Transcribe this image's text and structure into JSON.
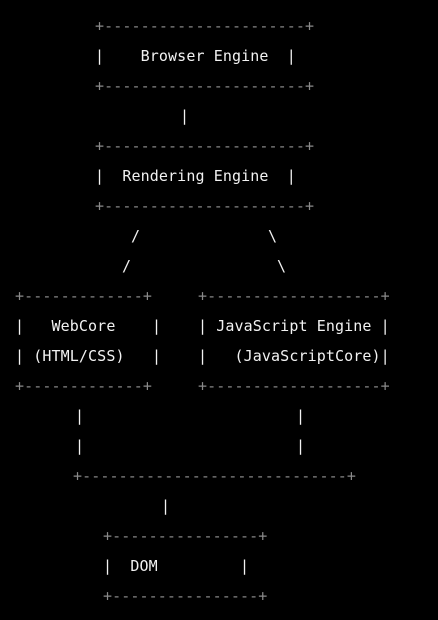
{
  "diagram": {
    "colors": {
      "background": "#000000",
      "text": "#f2f2f2",
      "border": "#8a8a8a"
    },
    "lines": [
      "          +----------------------+",
      "          |    Browser Engine    |",
      "          +----------------------+",
      "                    |",
      "          +----------------------+",
      "          |   Rendering Engine   |",
      "          +----------------------+",
      "              /              \\",
      "             /                \\",
      "  +----------------+    +----------------------+",
      "  |    WebCore     |    | JavaScript Engine    |",
      "  |  (HTML/CSS)    |    |  (JavaScriptCore)    |",
      "  +----------------+    +----------------------+",
      "        |                          |",
      "        |                          |",
      "        +--------------------------+",
      "                  |",
      "            +---------------+",
      "            |    DOM        |",
      "            +---------------+",
      ""
    ]
  }
}
